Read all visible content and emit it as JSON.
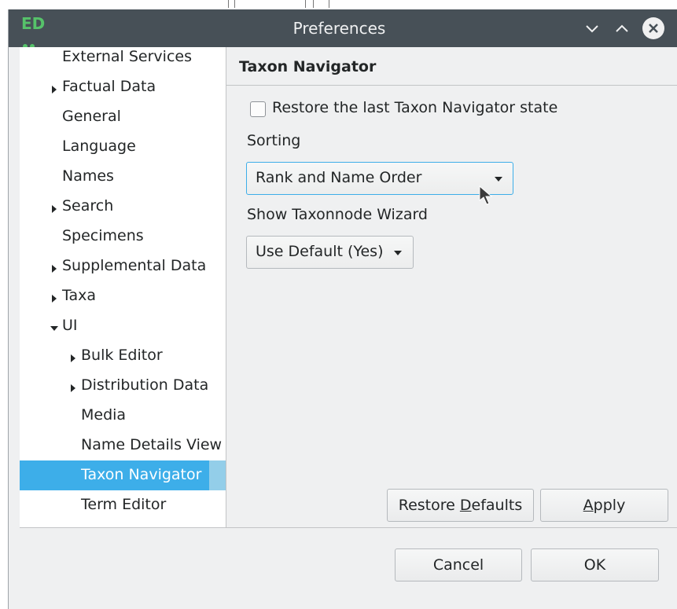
{
  "window": {
    "title": "Preferences",
    "app_icon_text": "ED"
  },
  "tree": {
    "items": [
      {
        "label": "External Services",
        "expandable": false,
        "expanded": false,
        "level": 0
      },
      {
        "label": "Factual Data",
        "expandable": true,
        "expanded": false,
        "level": 0
      },
      {
        "label": "General",
        "expandable": false,
        "expanded": false,
        "level": 0
      },
      {
        "label": "Language",
        "expandable": false,
        "expanded": false,
        "level": 0
      },
      {
        "label": "Names",
        "expandable": false,
        "expanded": false,
        "level": 0
      },
      {
        "label": "Search",
        "expandable": true,
        "expanded": false,
        "level": 0
      },
      {
        "label": "Specimens",
        "expandable": false,
        "expanded": false,
        "level": 0
      },
      {
        "label": "Supplemental Data",
        "expandable": true,
        "expanded": false,
        "level": 0
      },
      {
        "label": "Taxa",
        "expandable": true,
        "expanded": false,
        "level": 0
      },
      {
        "label": "UI",
        "expandable": true,
        "expanded": true,
        "level": 0
      },
      {
        "label": "Bulk Editor",
        "expandable": true,
        "expanded": false,
        "level": 1
      },
      {
        "label": "Distribution Data",
        "expandable": true,
        "expanded": false,
        "level": 1
      },
      {
        "label": "Media",
        "expandable": false,
        "expanded": false,
        "level": 1
      },
      {
        "label": "Name Details View",
        "expandable": false,
        "expanded": false,
        "level": 1
      },
      {
        "label": "Taxon Navigator",
        "expandable": false,
        "expanded": false,
        "level": 1,
        "selected": true
      },
      {
        "label": "Term Editor",
        "expandable": false,
        "expanded": false,
        "level": 1
      }
    ]
  },
  "pane": {
    "title": "Taxon Navigator",
    "restore_state_label": "Restore the last Taxon Navigator state",
    "restore_state_checked": false,
    "sorting_label": "Sorting",
    "sorting_value": "Rank and Name Order",
    "wizard_label": "Show Taxonnode Wizard",
    "wizard_value": "Use Default (Yes)",
    "restore_defaults_pre": "Restore ",
    "restore_defaults_mnemonic": "D",
    "restore_defaults_post": "efaults",
    "apply_mnemonic": "A",
    "apply_post": "pply"
  },
  "footer": {
    "cancel_label": "Cancel",
    "ok_label": "OK"
  },
  "colors": {
    "selection": "#3daee9",
    "titlebar": "#475057",
    "window_bg": "#eff0f1"
  },
  "icons": {
    "collapsed": "triangle-right-icon",
    "expanded": "triangle-down-icon",
    "combo": "caret-down-icon",
    "close": "close-circle-icon"
  }
}
